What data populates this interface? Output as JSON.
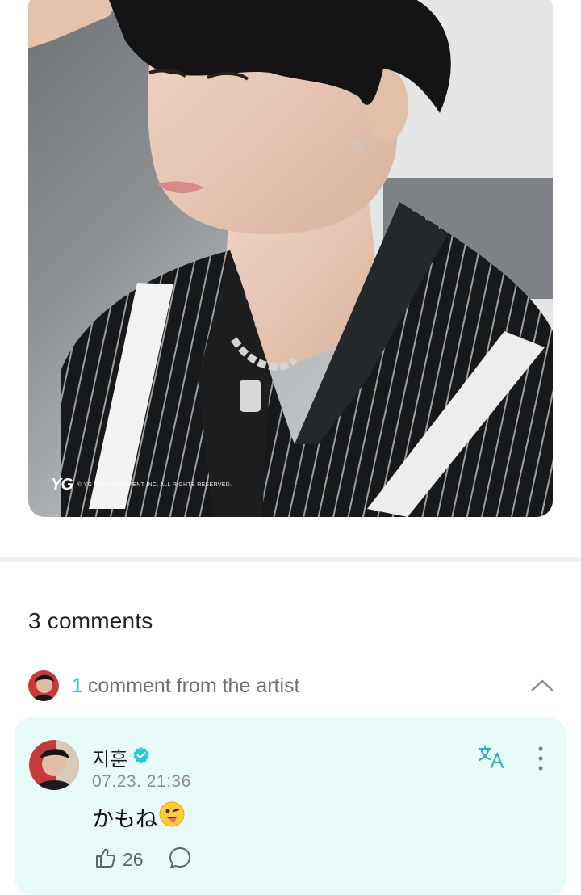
{
  "photo": {
    "watermark_logo": "YG",
    "watermark_text": "© YG ENTERTAINMENT INC. ALL RIGHTS RESERVED."
  },
  "comments": {
    "count_label": "3 comments",
    "artist_count": "1",
    "artist_label": "comment from the artist",
    "accent_color": "#1ecbd0"
  },
  "comment": {
    "author": "지훈",
    "verified": true,
    "date": "07.23. 21:36",
    "text": "かもね",
    "emoji": "😜",
    "likes": "26",
    "icons": [
      "verified-badge-icon",
      "translate-icon",
      "more-vertical-icon",
      "like-icon",
      "reply-icon",
      "chevron-up-icon"
    ],
    "card_color": "#e6fbf8"
  }
}
